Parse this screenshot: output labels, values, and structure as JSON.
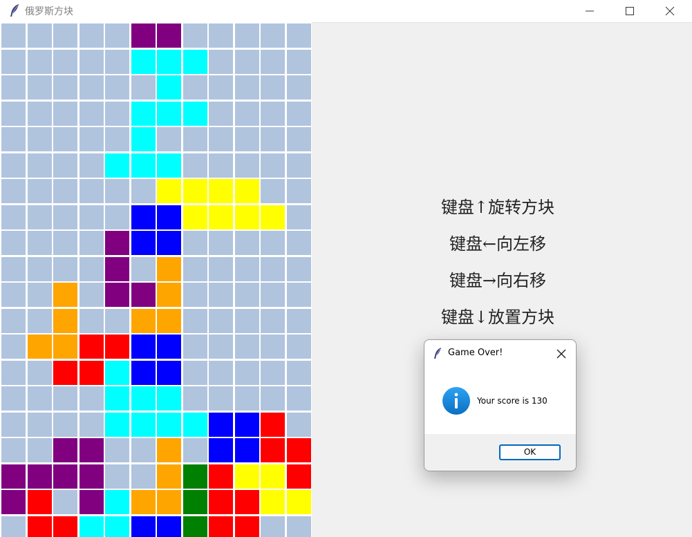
{
  "window": {
    "title": "俄罗斯方块",
    "app_icon": "feather-icon",
    "controls": [
      "minimize-icon",
      "maximize-icon",
      "close-icon"
    ]
  },
  "board": {
    "columns": 12,
    "rows": 20,
    "colors": {
      ".": "#b0c4de",
      "P": "#800080",
      "C": "#00ffff",
      "Y": "#ffff00",
      "B": "#0000ff",
      "O": "#ffa500",
      "R": "#ff0000",
      "G": "#008000"
    },
    "cells": [
      ".....PP.....",
      ".....CCC....",
      "......C.....",
      ".....CCC....",
      ".....C......",
      "....CCC.....",
      "......YYYY..",
      ".....BBYYYY.",
      "....PBB.....",
      "....P.O.....",
      "..O.PPO.....",
      "..O..OO.....",
      ".OORRBB.....",
      "..RRCBB.....",
      "....CCC.....",
      "....CCCCBBR.",
      "..PP..O.BBRR",
      "PPPP..OGRYYR",
      "PR.PCOOGRRYY",
      ".RRCCBBGRR.."
    ]
  },
  "instructions": [
    "键盘↑旋转方块",
    "键盘←向左移",
    "键盘→向右移",
    "键盘↓放置方块"
  ],
  "dialog": {
    "title": "Game Over!",
    "message": "Your score is 130",
    "icon": "info-icon",
    "ok_label": "OK"
  }
}
